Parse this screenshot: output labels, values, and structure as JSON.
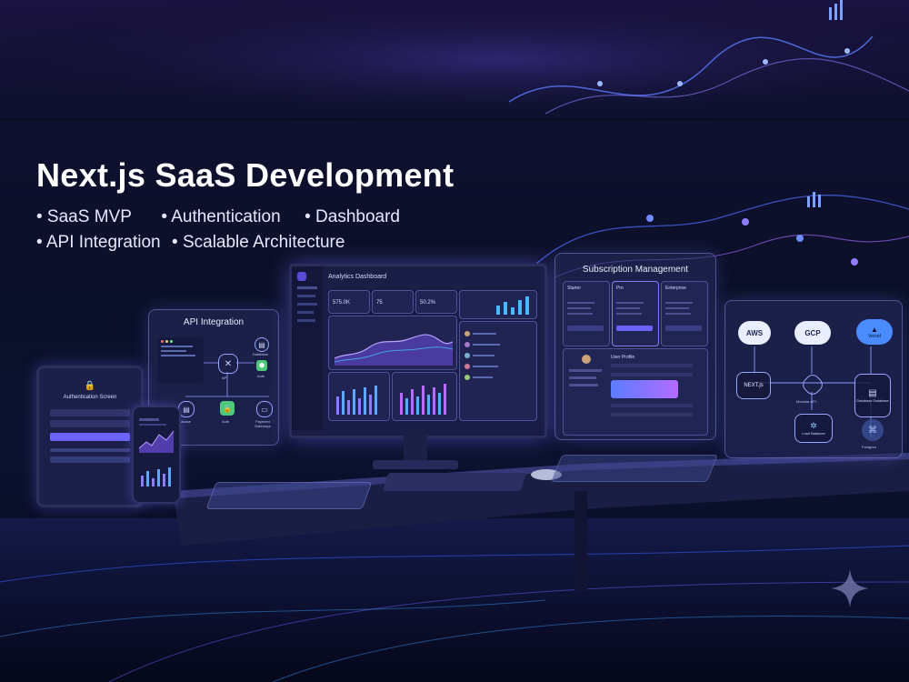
{
  "hero": {
    "headline": "Next.js SaaS Development",
    "bullets": [
      "• SaaS MVP",
      "• Authentication",
      "• Dashboard",
      "• API Integration",
      "• Scalable Architecture"
    ]
  },
  "panels": {
    "api_title": "API Integration",
    "api_nodes": [
      "API",
      "Database",
      "Auth",
      "Database",
      "Auth",
      "Payment Gateways"
    ],
    "auth_title": "Authentication Screen",
    "dashboard_title": "Analytics Dashboard",
    "dashboard_stats": [
      "575.0K",
      "75",
      "50.2%"
    ],
    "subscription_title": "Subscription Management",
    "plans": [
      "Starter",
      "Pro",
      "Enterprise"
    ],
    "user_profile": "User Profile",
    "arch_labels": {
      "aws": "AWS",
      "gcp": "GCP",
      "vercel": "Vercel",
      "next": "NEXT.js",
      "api": "Modular API",
      "db": "Database Database",
      "lb": "Load Balancer",
      "pg": "Postgres"
    }
  },
  "colors": {
    "accent": "#7c6cff",
    "cyan": "#49b8ff",
    "purple": "#b46cff",
    "green": "#4ec979"
  },
  "icons": {
    "sparkle": "sparkle-icon"
  }
}
